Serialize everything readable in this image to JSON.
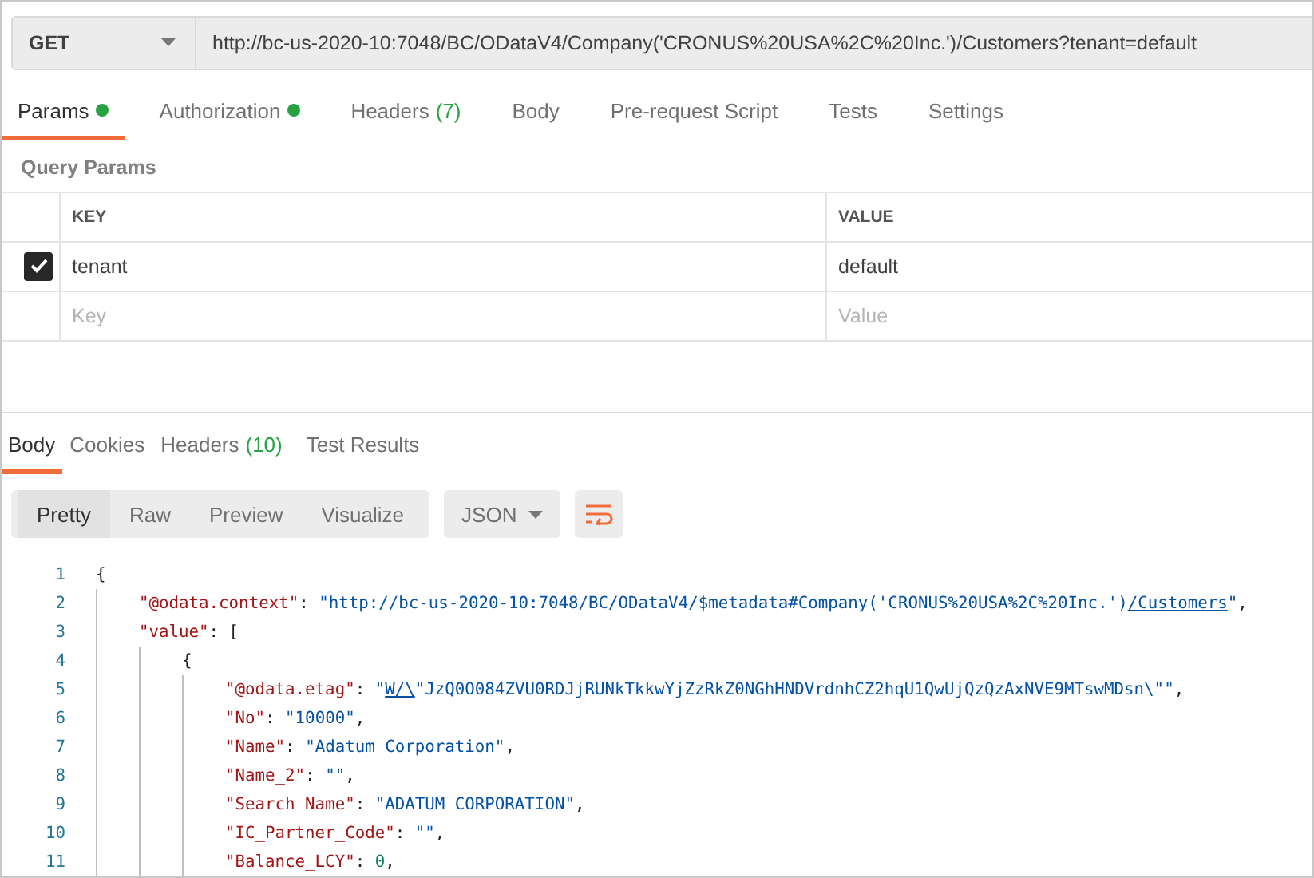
{
  "request": {
    "method": "GET",
    "url": "http://bc-us-2020-10:7048/BC/ODataV4/Company('CRONUS%20USA%2C%20Inc.')/Customers?tenant=default"
  },
  "request_tabs": [
    {
      "label": "Params",
      "selected": true,
      "dot": true
    },
    {
      "label": "Authorization",
      "selected": false,
      "dot": true
    },
    {
      "label": "Headers",
      "count": "(7)",
      "selected": false,
      "dot": false
    },
    {
      "label": "Body",
      "selected": false,
      "dot": false
    },
    {
      "label": "Pre-request Script",
      "selected": false,
      "dot": false
    },
    {
      "label": "Tests",
      "selected": false,
      "dot": false
    },
    {
      "label": "Settings",
      "selected": false,
      "dot": false
    }
  ],
  "query_params": {
    "title": "Query Params",
    "columns": [
      "KEY",
      "VALUE"
    ],
    "rows": [
      {
        "key": "tenant",
        "value": "default",
        "checked": true
      }
    ],
    "new_row": {
      "key_placeholder": "Key",
      "value_placeholder": "Value"
    }
  },
  "response_tabs": [
    {
      "label": "Body",
      "selected": true
    },
    {
      "label": "Cookies",
      "selected": false
    },
    {
      "label": "Headers",
      "count": "(10)",
      "selected": false
    },
    {
      "label": "Test Results",
      "selected": false
    }
  ],
  "view_modes": [
    {
      "label": "Pretty",
      "selected": true
    },
    {
      "label": "Raw",
      "selected": false
    },
    {
      "label": "Preview",
      "selected": false
    },
    {
      "label": "Visualize",
      "selected": false
    }
  ],
  "format": "JSON",
  "code": [
    {
      "number": "1",
      "segments": [
        {
          "kind": "punct",
          "text": "{"
        }
      ],
      "children": [
        {
          "number": "2",
          "segments": [
            {
              "kind": "key",
              "text": "\"@odata.context\""
            },
            {
              "kind": "punct",
              "text": ": "
            },
            {
              "kind": "string",
              "text": "\"http://bc-us-2020-10:7048/BC/ODataV4/$metadata#Company('CRONUS%20USA%2C%20Inc.')"
            },
            {
              "kind": "link",
              "text": "/Customers"
            },
            {
              "kind": "string",
              "text": "\""
            },
            {
              "kind": "punct",
              "text": ","
            }
          ]
        },
        {
          "number": "3",
          "segments": [
            {
              "kind": "key",
              "text": "\"value\""
            },
            {
              "kind": "punct",
              "text": ": ["
            }
          ],
          "children": [
            {
              "number": "4",
              "segments": [
                {
                  "kind": "punct",
                  "text": "{"
                }
              ],
              "children": [
                {
                  "number": "5",
                  "segments": [
                    {
                      "kind": "key",
                      "text": "\"@odata.etag\""
                    },
                    {
                      "kind": "punct",
                      "text": ": "
                    },
                    {
                      "kind": "string",
                      "text": "\""
                    },
                    {
                      "kind": "link",
                      "text": "W/\\"
                    },
                    {
                      "kind": "string",
                      "text": "\"JzQ0O084ZVU0RDJjRUNkTkkwYjZzRkZ0NGhHNDVrdnhCZ2hqU1QwUjQzQzAxNVE9MTswMDsn\\\"\""
                    },
                    {
                      "kind": "punct",
                      "text": ","
                    }
                  ]
                },
                {
                  "number": "6",
                  "segments": [
                    {
                      "kind": "key",
                      "text": "\"No\""
                    },
                    {
                      "kind": "punct",
                      "text": ": "
                    },
                    {
                      "kind": "string",
                      "text": "\"10000\""
                    },
                    {
                      "kind": "punct",
                      "text": ","
                    }
                  ]
                },
                {
                  "number": "7",
                  "segments": [
                    {
                      "kind": "key",
                      "text": "\"Name\""
                    },
                    {
                      "kind": "punct",
                      "text": ": "
                    },
                    {
                      "kind": "string",
                      "text": "\"Adatum Corporation\""
                    },
                    {
                      "kind": "punct",
                      "text": ","
                    }
                  ]
                },
                {
                  "number": "8",
                  "segments": [
                    {
                      "kind": "key",
                      "text": "\"Name_2\""
                    },
                    {
                      "kind": "punct",
                      "text": ": "
                    },
                    {
                      "kind": "string",
                      "text": "\"\""
                    },
                    {
                      "kind": "punct",
                      "text": ","
                    }
                  ]
                },
                {
                  "number": "9",
                  "segments": [
                    {
                      "kind": "key",
                      "text": "\"Search_Name\""
                    },
                    {
                      "kind": "punct",
                      "text": ": "
                    },
                    {
                      "kind": "string",
                      "text": "\"ADATUM CORPORATION\""
                    },
                    {
                      "kind": "punct",
                      "text": ","
                    }
                  ]
                },
                {
                  "number": "10",
                  "segments": [
                    {
                      "kind": "key",
                      "text": "\"IC_Partner_Code\""
                    },
                    {
                      "kind": "punct",
                      "text": ": "
                    },
                    {
                      "kind": "string",
                      "text": "\"\""
                    },
                    {
                      "kind": "punct",
                      "text": ","
                    }
                  ]
                },
                {
                  "number": "11",
                  "segments": [
                    {
                      "kind": "key",
                      "text": "\"Balance_LCY\""
                    },
                    {
                      "kind": "punct",
                      "text": ": "
                    },
                    {
                      "kind": "number",
                      "text": "0"
                    },
                    {
                      "kind": "punct",
                      "text": ","
                    }
                  ]
                }
              ]
            }
          ]
        }
      ]
    }
  ]
}
